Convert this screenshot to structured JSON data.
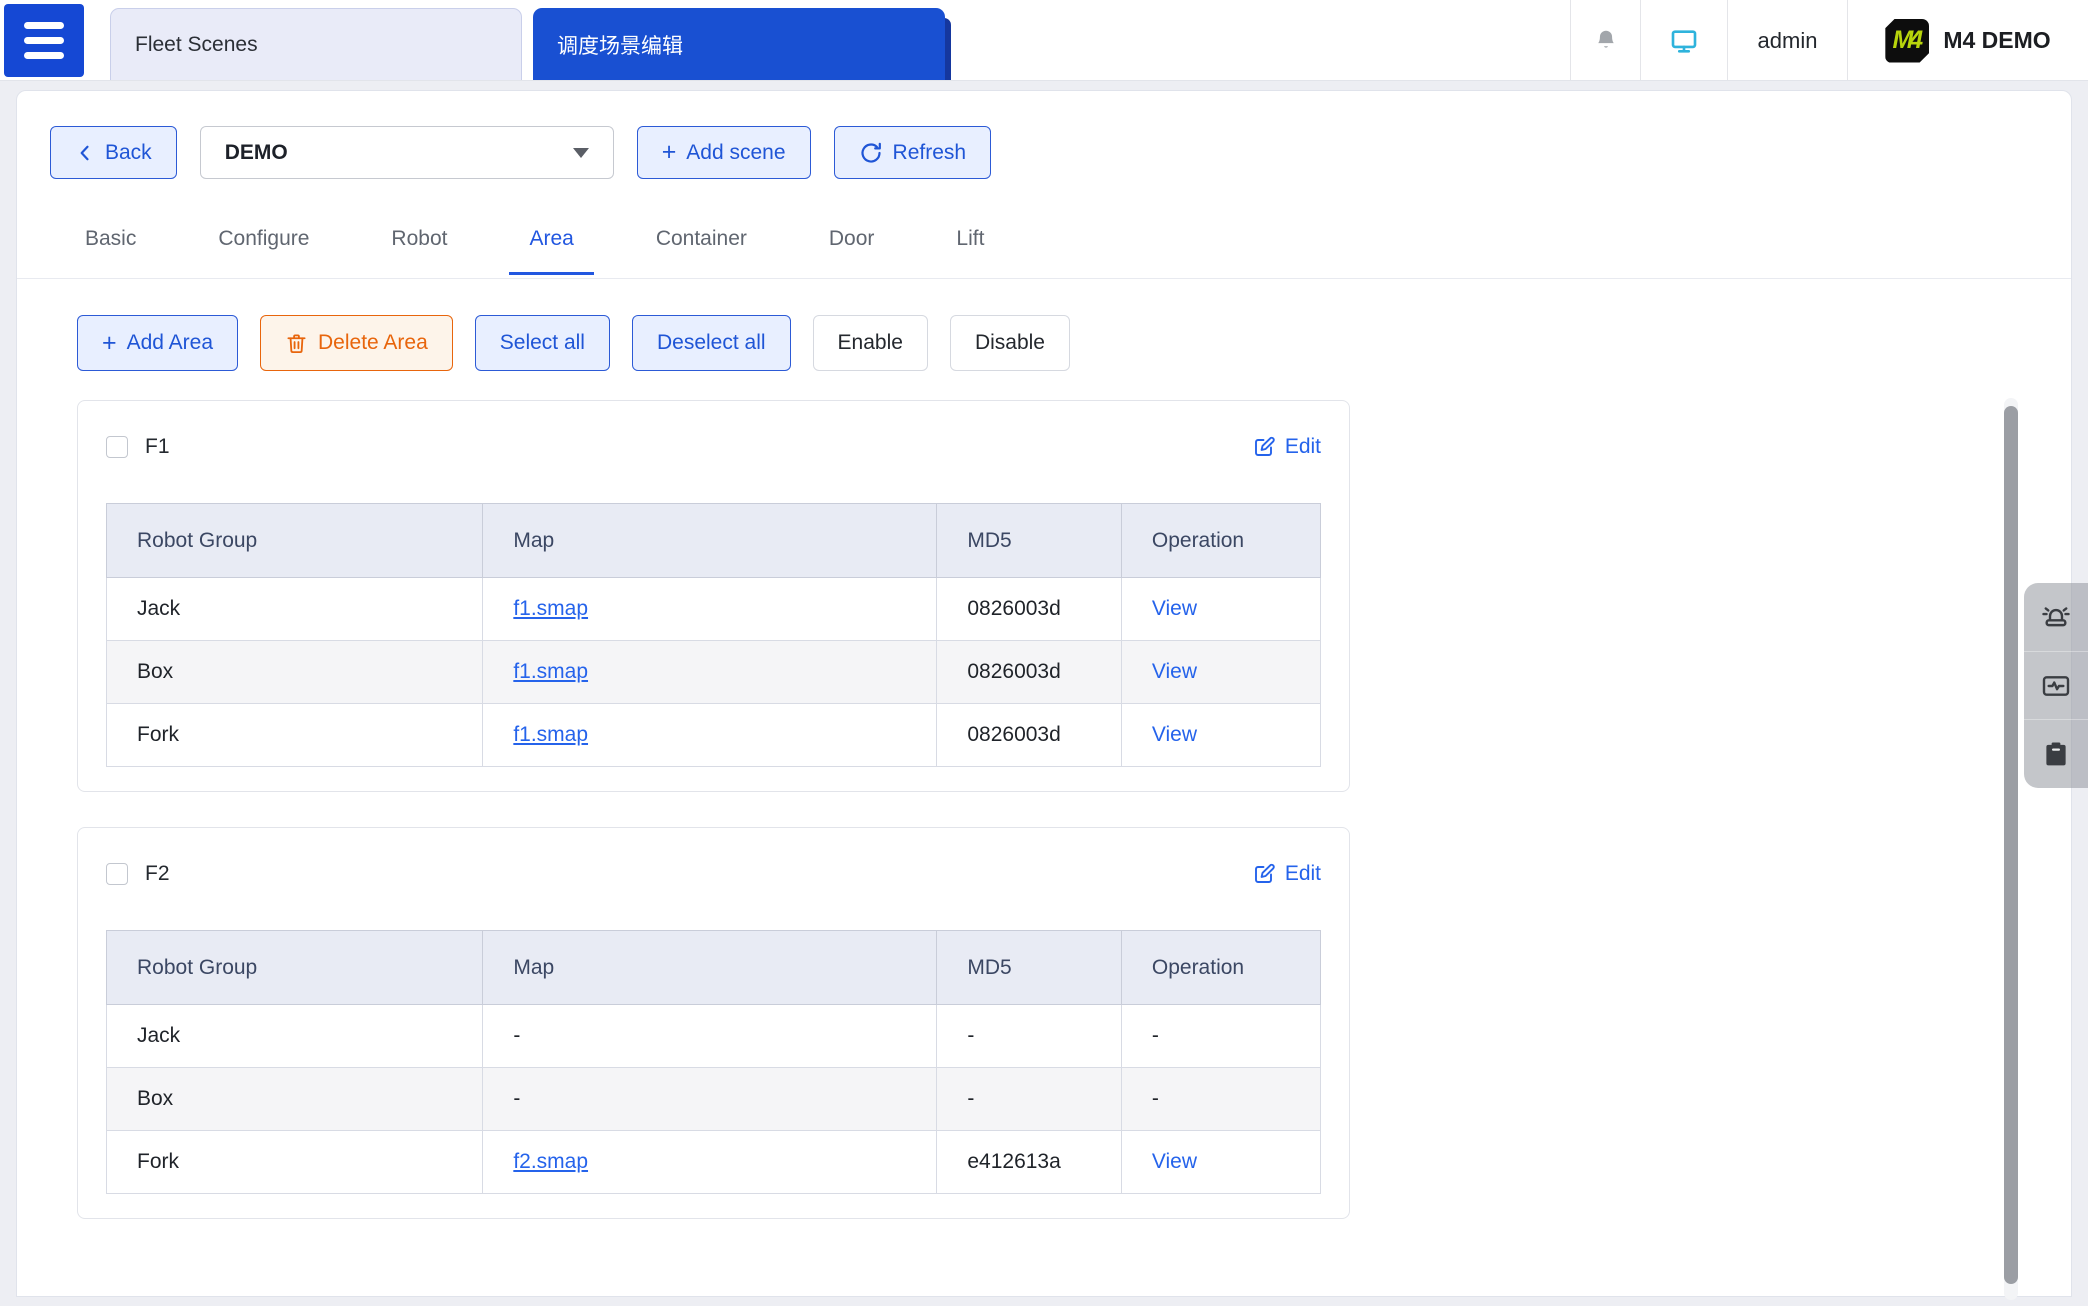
{
  "topbar": {
    "tabs": [
      {
        "label": "Fleet Scenes"
      },
      {
        "label": "调度场景编辑"
      }
    ],
    "user": "admin",
    "brand": "M4 DEMO",
    "logo_text": "M4"
  },
  "toolbar": {
    "back": "Back",
    "scene_select": "DEMO",
    "add_scene": "Add scene",
    "refresh": "Refresh"
  },
  "nav_tabs": {
    "items": [
      "Basic",
      "Configure",
      "Robot",
      "Area",
      "Container",
      "Door",
      "Lift"
    ],
    "active": "Area"
  },
  "actions": {
    "add_area": "Add Area",
    "delete_area": "Delete Area",
    "select_all": "Select all",
    "deselect_all": "Deselect all",
    "enable": "Enable",
    "disable": "Disable"
  },
  "card": {
    "edit": "Edit",
    "columns": [
      "Robot Group",
      "Map",
      "MD5",
      "Operation"
    ]
  },
  "areas": [
    {
      "name": "F1",
      "rows": [
        {
          "group": "Jack",
          "map": "f1.smap",
          "map_link": true,
          "md5": "0826003d",
          "operation": "View",
          "operation_link": true
        },
        {
          "group": "Box",
          "map": "f1.smap",
          "map_link": true,
          "md5": "0826003d",
          "operation": "View",
          "operation_link": true
        },
        {
          "group": "Fork",
          "map": "f1.smap",
          "map_link": true,
          "md5": "0826003d",
          "operation": "View",
          "operation_link": true
        }
      ]
    },
    {
      "name": "F2",
      "rows": [
        {
          "group": "Jack",
          "map": "-",
          "map_link": false,
          "md5": "-",
          "operation": "-",
          "operation_link": false
        },
        {
          "group": "Box",
          "map": "-",
          "map_link": false,
          "md5": "-",
          "operation": "-",
          "operation_link": false
        },
        {
          "group": "Fork",
          "map": "f2.smap",
          "map_link": true,
          "md5": "e412613a",
          "operation": "View",
          "operation_link": true
        }
      ]
    }
  ],
  "colors": {
    "primary_blue": "#2155d4",
    "link_blue": "#2563eb",
    "active_tab_blue": "#1950d2",
    "orange": "#e8650c",
    "brand_green": "#b8d40c",
    "monitor_cyan": "#2eb3dc"
  }
}
